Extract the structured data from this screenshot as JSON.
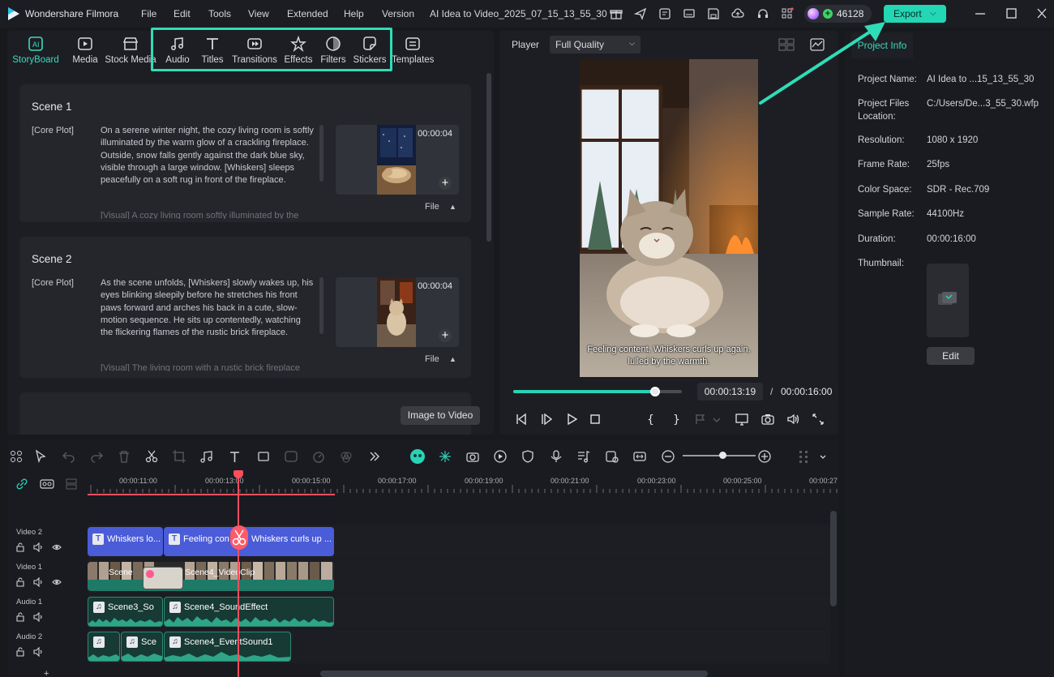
{
  "app": {
    "name": "Wondershare Filmora",
    "doc_title": "AI Idea to Video_2025_07_15_13_55_30"
  },
  "menu": [
    "File",
    "Edit",
    "Tools",
    "View",
    "Extended",
    "Help",
    "Version"
  ],
  "credits": {
    "count": "46128"
  },
  "export": {
    "label": "Export"
  },
  "toolbar": {
    "storyboard": "StoryBoard",
    "media": "Media",
    "stock_media": "Stock Media",
    "audio": "Audio",
    "titles": "Titles",
    "transitions": "Transitions",
    "effects": "Effects",
    "filters": "Filters",
    "stickers": "Stickers",
    "templates": "Templates"
  },
  "scenes": [
    {
      "title": "Scene 1",
      "tag": "[Core Plot]",
      "text": "On a serene winter night, the cozy living room is softly illuminated by the warm glow of a crackling fireplace. Outside, snow falls gently against the dark blue sky, visible through a large window. [Whiskers] sleeps peacefully on a soft rug in front of the fireplace.",
      "cut_text": "[Visual]        A cozy living room softly illuminated by the",
      "duration": "00:00:04",
      "file": "File"
    },
    {
      "title": "Scene 2",
      "tag": "[Core Plot]",
      "text": "As the scene unfolds, [Whiskers] slowly wakes up, his eyes blinking sleepily before he stretches his front paws forward and arches his back in a cute, slow-motion sequence. He sits up contentedly, watching the flickering flames of the rustic brick fireplace.",
      "cut_text": "[Visual]        The living room with a rustic brick fireplace and",
      "duration": "00:00:04",
      "file": "File"
    }
  ],
  "image_to_video": "Image to Video",
  "player": {
    "label": "Player",
    "quality": "Full Quality",
    "caption": "Feeling content, Whiskers curls up again, lulled by the warmth.",
    "progress": 0.84,
    "current_time": "00:00:13:19",
    "separator": "/",
    "duration": "00:00:16:00"
  },
  "project_info": {
    "tab": "Project Info",
    "fields": [
      {
        "label": "Project Name:",
        "value": "AI Idea to ...15_13_55_30"
      },
      {
        "label": "Project Files Location:",
        "value": "C:/Users/De...3_55_30.wfp"
      },
      {
        "label": "Resolution:",
        "value": "1080 x 1920"
      },
      {
        "label": "Frame Rate:",
        "value": "25fps"
      },
      {
        "label": "Color Space:",
        "value": "SDR - Rec.709"
      },
      {
        "label": "Sample Rate:",
        "value": "44100Hz"
      },
      {
        "label": "Duration:",
        "value": "00:00:16:00"
      },
      {
        "label": "Thumbnail:",
        "value": ""
      }
    ],
    "edit": "Edit"
  },
  "timeline": {
    "ruler": [
      "00:00:11:00",
      "00:00:13:00",
      "00:00:15:00",
      "00:00:17:00",
      "00:00:19:00",
      "00:00:21:00",
      "00:00:23:00",
      "00:00:25:00",
      "00:00:27"
    ],
    "tracks": [
      {
        "name": "Video 2",
        "clips": [
          "Whiskers lo...",
          "Feeling con",
          "Whiskers curls up ..."
        ]
      },
      {
        "name": "Video 1",
        "clips": [
          "Scene",
          "Scene4_VideoClip"
        ]
      },
      {
        "name": "Audio 1",
        "clips": [
          "Scene3_So",
          "Scene4_SoundEffect"
        ]
      },
      {
        "name": "Audio 2",
        "clips": [
          "",
          "Sce",
          "Scene4_EventSound1"
        ]
      }
    ]
  },
  "colors": {
    "accent": "#23d6b4",
    "playhead": "#ff4d5e",
    "title_clip": "#4a5cd8"
  }
}
